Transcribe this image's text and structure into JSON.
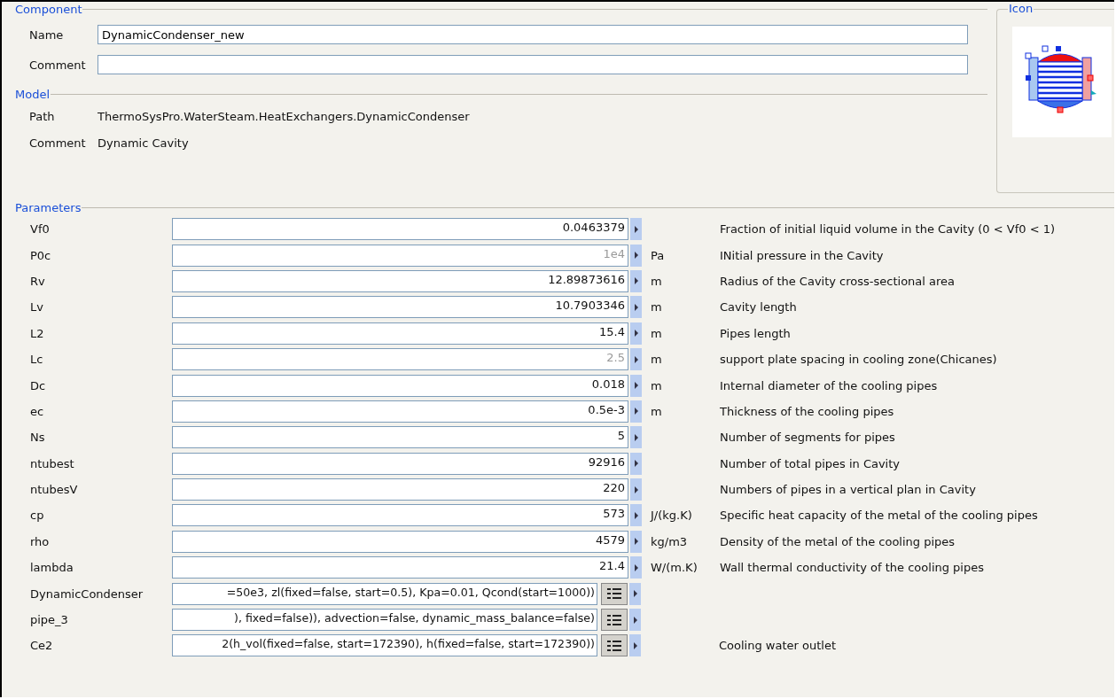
{
  "component": {
    "title": "Component",
    "name_label": "Name",
    "name_value": "DynamicCondenser_new",
    "comment_label": "Comment"
  },
  "icon": {
    "title": "Icon"
  },
  "model": {
    "title": "Model",
    "path_label": "Path",
    "path_value": "ThermoSysPro.WaterSteam.HeatExchangers.DynamicCondenser",
    "comment_label": "Comment",
    "comment_value": "Dynamic Cavity"
  },
  "parameters": {
    "title": "Parameters",
    "rows": [
      {
        "kind": "value",
        "name": "Vf0",
        "value": "0.0463379",
        "default": false,
        "description": "Fraction of initial liquid volume in the Cavity (0 < Vf0 < 1)"
      },
      {
        "kind": "value",
        "name": "P0c",
        "value": "1e4",
        "default": true,
        "unit": "Pa",
        "description": "INitial pressure in the Cavity"
      },
      {
        "kind": "value",
        "name": "Rv",
        "value": "12.89873616",
        "default": false,
        "unit": "m",
        "description": "Radius of the Cavity cross-sectional area"
      },
      {
        "kind": "value",
        "name": "Lv",
        "value": "10.7903346",
        "default": false,
        "unit": "m",
        "description": "Cavity length"
      },
      {
        "kind": "value",
        "name": "L2",
        "value": "15.4",
        "default": false,
        "unit": "m",
        "description": "Pipes length"
      },
      {
        "kind": "value",
        "name": "Lc",
        "value": "2.5",
        "default": true,
        "unit": "m",
        "description": "support plate spacing in cooling zone(Chicanes)"
      },
      {
        "kind": "value",
        "name": "Dc",
        "value": "0.018",
        "default": false,
        "unit": "m",
        "description": "Internal diameter of the cooling pipes"
      },
      {
        "kind": "value",
        "name": "ec",
        "value": "0.5e-3",
        "default": false,
        "unit": "m",
        "description": "Thickness of the cooling pipes"
      },
      {
        "kind": "value",
        "name": "Ns",
        "value": "5",
        "default": false,
        "description": "Number of segments for pipes"
      },
      {
        "kind": "value",
        "name": "ntubest",
        "value": "92916",
        "default": false,
        "description": "Number of total pipes in Cavity"
      },
      {
        "kind": "value",
        "name": "ntubesV",
        "value": "220",
        "default": false,
        "description": "Numbers of pipes in a vertical plan in Cavity"
      },
      {
        "kind": "value",
        "name": "cp",
        "value": "573",
        "default": false,
        "unit": "J/(kg.K)",
        "description": "Specific heat capacity of the metal of the cooling pipes"
      },
      {
        "kind": "value",
        "name": "rho",
        "value": "4579",
        "default": false,
        "unit": "kg/m3",
        "description": "Density of the metal of the cooling pipes"
      },
      {
        "kind": "value",
        "name": "lambda",
        "value": "21.4",
        "default": false,
        "unit": "W/(m.K)",
        "description": "Wall thermal conductivity of the cooling pipes"
      },
      {
        "kind": "modifier",
        "name": "DynamicCondenser",
        "value": "=50e3, zl(fixed=false, start=0.5), Kpa=0.01, Qcond(start=1000))",
        "default": false
      },
      {
        "kind": "modifier",
        "name": "pipe_3",
        "value": "), fixed=false)), advection=false, dynamic_mass_balance=false)",
        "default": false
      },
      {
        "kind": "modifier",
        "name": "Ce2",
        "value": "2(h_vol(fixed=false, start=172390), h(fixed=false, start=172390))",
        "default": false,
        "description": "Cooling water outlet"
      }
    ]
  }
}
